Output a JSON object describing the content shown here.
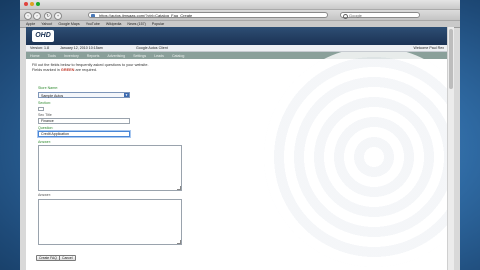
{
  "window": {
    "title": ""
  },
  "browser": {
    "url": "https://autos.jimsaas.com/?ctrl=Catalog_Faq_Create",
    "search_placeholder": "Google",
    "bookmarks": [
      "Apple",
      "Yahoo!",
      "Google Maps",
      "YouTube",
      "Wikipedia",
      "News (157)",
      "Popular"
    ],
    "lights": [
      "#e0443e",
      "#dea123",
      "#1aab29"
    ]
  },
  "app": {
    "logo": "OHD",
    "info": [
      "Version: 1.8",
      "January 12, 2010 10:15am",
      "Google Autos Client",
      "Welcome Paul Rex"
    ],
    "nav": [
      "Home",
      "Tools",
      "Inventory",
      "Reports",
      "Advertising",
      "Settings",
      "Leads",
      "Catalog"
    ]
  },
  "form": {
    "intro": "Fill out the fields below to frequently asked questions to your website.",
    "required_text": "Fields marked in",
    "required_color_word": "GREEN",
    "required_suffix": "are required.",
    "store_label": "Store Name:",
    "store_value": "Sample Autos",
    "section_label": "Section:",
    "section_sub": "Sec Title",
    "section_value": "Finance",
    "question_label": "Question:",
    "question_value": "Credit Application",
    "answer_label": "Answer:",
    "answer2_label": "Answer:",
    "create_button": "Create FAQ",
    "cancel_button": "Cancel"
  }
}
